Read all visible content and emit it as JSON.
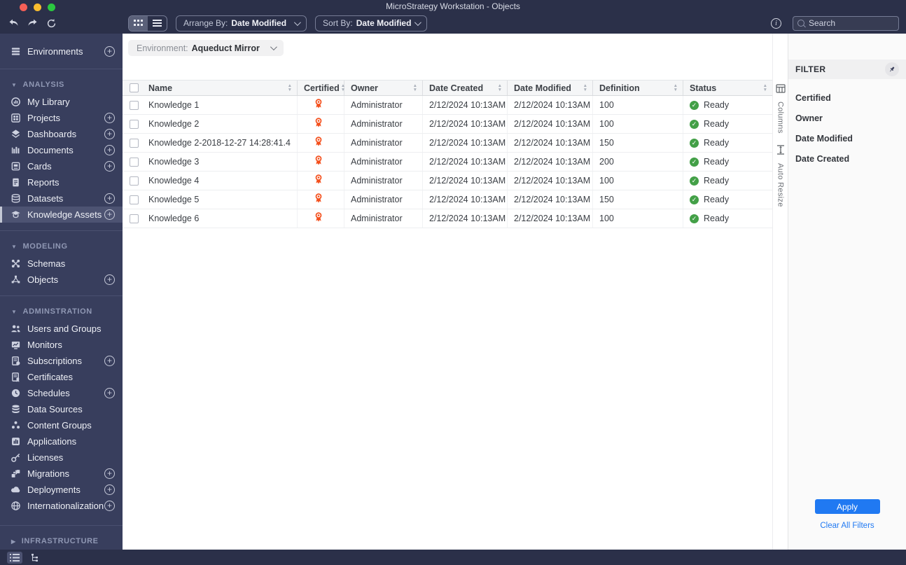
{
  "window": {
    "title": "MicroStrategy Workstation - Objects"
  },
  "toolbar": {
    "arrange_by_label": "Arrange By:",
    "arrange_by_value": "Date Modified",
    "sort_by_label": "Sort By:",
    "sort_by_value": "Date Modified",
    "search_placeholder": "Search"
  },
  "environment_bar": {
    "label": "Environment:",
    "value": "Aqueduct Mirror"
  },
  "sidebar": {
    "environments_label": "Environments",
    "sections": [
      {
        "title": "ANALYSIS",
        "items": [
          {
            "label": "My Library"
          },
          {
            "label": "Projects"
          },
          {
            "label": "Dashboards"
          },
          {
            "label": "Documents"
          },
          {
            "label": "Cards"
          },
          {
            "label": "Reports"
          },
          {
            "label": "Datasets"
          },
          {
            "label": "Knowledge Assets"
          }
        ]
      },
      {
        "title": "MODELING",
        "items": [
          {
            "label": "Schemas"
          },
          {
            "label": "Objects"
          }
        ]
      },
      {
        "title": "ADMINSTRATION",
        "items": [
          {
            "label": "Users and Groups"
          },
          {
            "label": "Monitors"
          },
          {
            "label": "Subscriptions"
          },
          {
            "label": "Certificates"
          },
          {
            "label": "Schedules"
          },
          {
            "label": "Data Sources"
          },
          {
            "label": "Content Groups"
          },
          {
            "label": "Applications"
          },
          {
            "label": "Licenses"
          },
          {
            "label": "Migrations"
          },
          {
            "label": "Deployments"
          },
          {
            "label": "Internationalization"
          }
        ]
      },
      {
        "title": "INFRASTRUCTURE",
        "items": []
      }
    ]
  },
  "table": {
    "headers": {
      "name": "Name",
      "certified": "Certified",
      "owner": "Owner",
      "date_created": "Date Created",
      "date_modified": "Date Modified",
      "definition": "Definition",
      "status": "Status"
    },
    "rows": [
      {
        "name": "Knowledge 1",
        "owner": "Administrator",
        "date_created": "2/12/2024 10:13AM",
        "date_modified": "2/12/2024 10:13AM",
        "definition": "100",
        "status": "Ready"
      },
      {
        "name": "Knowledge 2",
        "owner": "Administrator",
        "date_created": "2/12/2024 10:13AM",
        "date_modified": "2/12/2024 10:13AM",
        "definition": "100",
        "status": "Ready"
      },
      {
        "name": "Knowledge 2-2018-12-27 14:28:41.4",
        "owner": "Administrator",
        "date_created": "2/12/2024 10:13AM",
        "date_modified": "2/12/2024 10:13AM",
        "definition": "150",
        "status": "Ready"
      },
      {
        "name": "Knowledge 3",
        "owner": "Administrator",
        "date_created": "2/12/2024 10:13AM",
        "date_modified": "2/12/2024 10:13AM",
        "definition": "200",
        "status": "Ready"
      },
      {
        "name": "Knowledge 4",
        "owner": "Administrator",
        "date_created": "2/12/2024 10:13AM",
        "date_modified": "2/12/2024 10:13AM",
        "definition": "100",
        "status": "Ready"
      },
      {
        "name": "Knowledge 5",
        "owner": "Administrator",
        "date_created": "2/12/2024 10:13AM",
        "date_modified": "2/12/2024 10:13AM",
        "definition": "150",
        "status": "Ready"
      },
      {
        "name": "Knowledge 6",
        "owner": "Administrator",
        "date_created": "2/12/2024 10:13AM",
        "date_modified": "2/12/2024 10:13AM",
        "definition": "100",
        "status": "Ready"
      }
    ]
  },
  "right_rail": {
    "columns_label": "Columns",
    "auto_resize_label": "Auto Resize"
  },
  "filter": {
    "title": "FILTER",
    "items": [
      "Certified",
      "Owner",
      "Date Modified",
      "Date Created"
    ],
    "apply_label": "Apply",
    "clear_all_label": "Clear All Filters"
  },
  "colors": {
    "accent_blue": "#2079f2",
    "status_green": "#43a047",
    "certified_orange": "#f4511e",
    "sidebar_bg": "#383e5d",
    "titlebar_bg": "#2b3049"
  }
}
